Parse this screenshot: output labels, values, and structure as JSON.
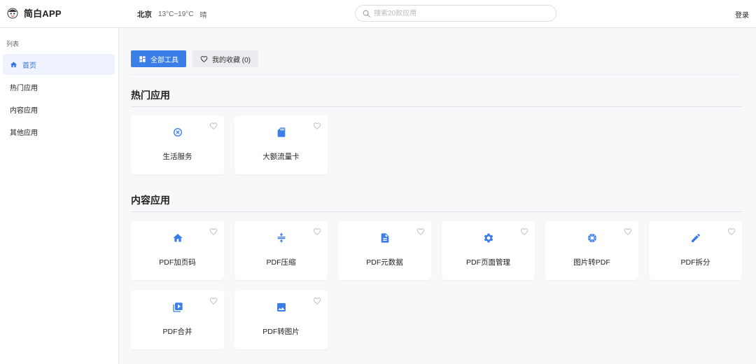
{
  "brand": {
    "name": "简白APP"
  },
  "weather": {
    "city": "北京",
    "temp": "13°C~19°C",
    "condition": "晴"
  },
  "search": {
    "placeholder": "搜索20款应用"
  },
  "header": {
    "login_label": "登录"
  },
  "sidebar": {
    "section_label": "列表",
    "items": [
      {
        "label": "首页",
        "icon": "home-icon",
        "active": true
      },
      {
        "label": "热门应用",
        "active": false
      },
      {
        "label": "内容应用",
        "active": false
      },
      {
        "label": "其他应用",
        "active": false
      }
    ]
  },
  "tabs": {
    "all_tools": "全部工具",
    "favorites": "我的收藏 (0)"
  },
  "sections": {
    "hot": {
      "title": "热门应用",
      "apps": [
        {
          "label": "生活服务",
          "icon": "life-service-icon"
        },
        {
          "label": "大额流量卡",
          "icon": "sim-card-icon"
        }
      ]
    },
    "content": {
      "title": "内容应用",
      "apps": [
        {
          "label": "PDF加页码",
          "icon": "home-icon"
        },
        {
          "label": "PDF压缩",
          "icon": "compress-icon"
        },
        {
          "label": "PDF元数据",
          "icon": "document-icon"
        },
        {
          "label": "PDF页面管理",
          "icon": "gear-icon"
        },
        {
          "label": "图片转PDF",
          "icon": "aperture-icon"
        },
        {
          "label": "PDF拆分",
          "icon": "pencil-icon"
        },
        {
          "label": "PDF合并",
          "icon": "video-library-icon"
        },
        {
          "label": "PDF转图片",
          "icon": "image-icon"
        }
      ]
    }
  },
  "colors": {
    "accent": "#3c7ee8",
    "active_bg": "#eef3fd",
    "background": "#f7f8fa"
  }
}
